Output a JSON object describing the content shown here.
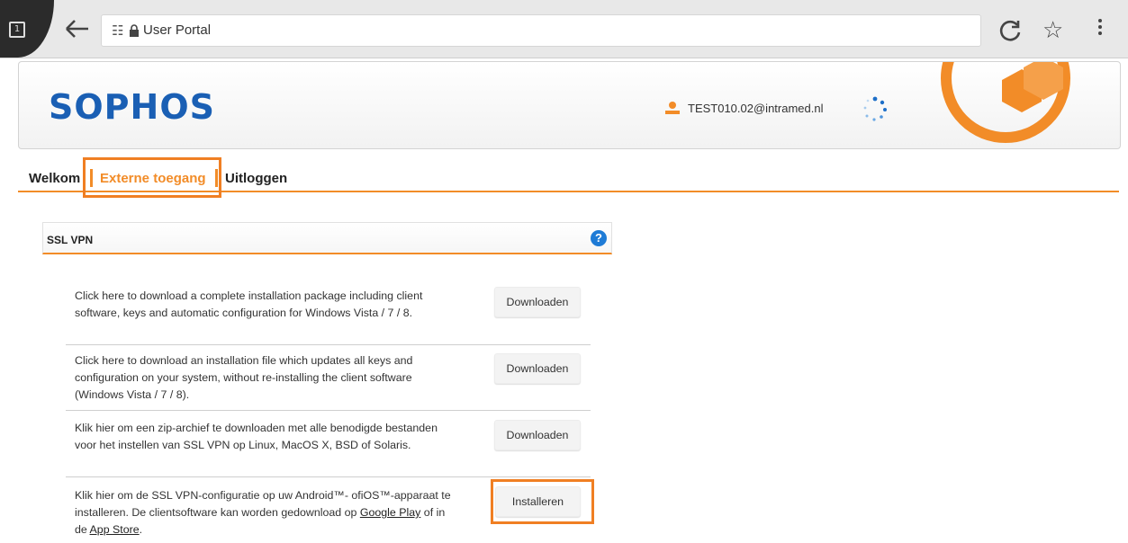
{
  "browser": {
    "tab_count": "1",
    "url_text": "User Portal"
  },
  "header": {
    "logo": "SOPHOS",
    "user_email": "TEST010.02@intramed.nl",
    "brand_color": "#f28c28",
    "logo_color": "#1a5fb4"
  },
  "nav": {
    "items": [
      "Welkom",
      "Externe toegang",
      "Uitloggen"
    ],
    "active_index": 1
  },
  "panel": {
    "title": "SSL VPN",
    "help": "?"
  },
  "rows": [
    {
      "description": "Click here to download a complete installation package including client software, keys and automatic configuration for Windows Vista / 7 / 8.",
      "button": "Downloaden"
    },
    {
      "description": "Click here to download an installation file which updates all keys and configuration on your system, without re-installing the client software (Windows Vista / 7 / 8).",
      "button": "Downloaden"
    },
    {
      "description": "Klik hier om een zip-archief te downloaden met alle benodigde bestanden voor het instellen van SSL VPN op Linux, MacOS X, BSD of Solaris.",
      "button": "Downloaden"
    },
    {
      "description_parts": {
        "pre": "Klik hier om de SSL VPN-configuratie op uw Android™- ofiOS™-apparaat te installeren. De clientsoftware kan worden gedownload op ",
        "link1": "Google Play",
        "mid": " of in de ",
        "link2": "App Store",
        "post": "."
      },
      "button": "Installeren"
    }
  ]
}
